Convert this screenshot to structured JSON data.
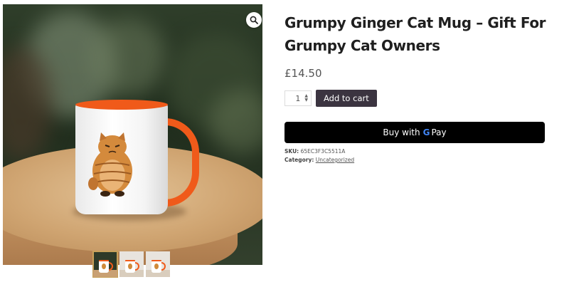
{
  "product": {
    "title": "Grumpy Ginger Cat Mug – Gift For Grumpy Cat Owners",
    "price": "£14.50",
    "quantity": "1",
    "add_to_cart_label": "Add to cart",
    "gpay": {
      "prefix": "Buy with",
      "g_letter": "G",
      "pay_label": "Pay"
    },
    "meta": {
      "sku_label": "SKU:",
      "sku_value": "65EC3F3C5511A",
      "category_label": "Category:",
      "category_value": "Uncategorized"
    }
  },
  "gallery": {
    "zoom_icon": "magnifier-icon",
    "thumbnail_count": 3
  },
  "colors": {
    "mug_accent": "#f05a1a",
    "add_to_cart_bg": "#3b3440",
    "gpay_bg": "#000000",
    "thumb_active_border": "#c8a15a"
  }
}
